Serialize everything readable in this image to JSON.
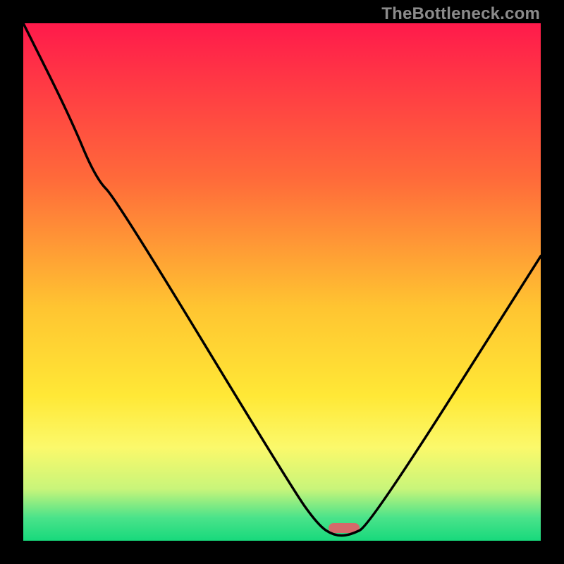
{
  "watermark": "TheBottleneck.com",
  "chart_data": {
    "type": "line",
    "title": "",
    "xlabel": "",
    "ylabel": "",
    "xlim": [
      0,
      100
    ],
    "ylim": [
      0,
      100
    ],
    "grid": false,
    "legend": false,
    "background_gradient_stops": [
      {
        "pos": 0.0,
        "color": "#ff1a4b"
      },
      {
        "pos": 0.3,
        "color": "#ff6a3a"
      },
      {
        "pos": 0.55,
        "color": "#ffc531"
      },
      {
        "pos": 0.72,
        "color": "#ffe836"
      },
      {
        "pos": 0.82,
        "color": "#fbf96b"
      },
      {
        "pos": 0.9,
        "color": "#c8f57a"
      },
      {
        "pos": 0.955,
        "color": "#4be38a"
      },
      {
        "pos": 1.0,
        "color": "#17d97c"
      }
    ],
    "series": [
      {
        "name": "bottleneck-curve",
        "x": [
          0,
          9,
          14,
          18,
          52,
          57,
          60,
          63,
          67,
          100
        ],
        "y": [
          100,
          82,
          70,
          66,
          10,
          3,
          1,
          1,
          3,
          55
        ]
      }
    ],
    "marker": {
      "name": "optimal-range",
      "x_start": 59,
      "x_end": 65,
      "color": "#d46a6a"
    }
  }
}
